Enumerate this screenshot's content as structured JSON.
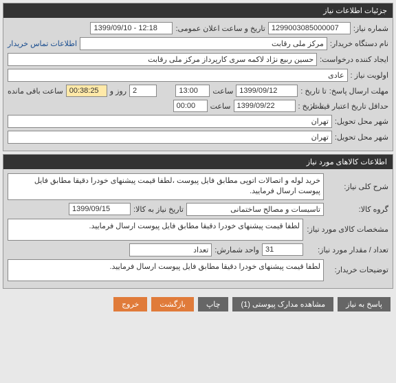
{
  "panel1": {
    "title": "جزئیات اطلاعات نیاز",
    "req_no_label": "شماره نیاز:",
    "req_no": "1299003085000007",
    "pub_date_label": "تاریخ و ساعت اعلان عمومی:",
    "pub_date": "1399/09/10 - 12:18",
    "buyer_label": "نام دستگاه خریدار:",
    "buyer": "مرکز ملی رقابت",
    "contact_link": "اطلاعات تماس خریدار",
    "creator_label": "ایجاد کننده درخواست:",
    "creator": "حسین ربیع نژاد لاکمه سری کارپرداز مرکز ملی رقابت",
    "priority_label": "اولویت نیاز :",
    "priority": "عادی",
    "deadline_label": "مهلت ارسال پاسخ:",
    "to_date_label": "تا تاریخ :",
    "deadline_date": "1399/09/12",
    "time_label": "ساعت",
    "deadline_time": "13:00",
    "days_val": "2",
    "days_label": "روز و",
    "remain_time": "00:38:25",
    "remain_label": "ساعت باقی مانده",
    "min_credit_label": "حداقل تاریخ اعتبار قیمت:",
    "min_credit_date": "1399/09/22",
    "min_credit_time": "00:00",
    "deliver_city_label": "شهر محل تحویل:",
    "deliver_city": "تهران",
    "deliver_city2_label": "شهر محل تحویل:",
    "deliver_city2": "تهران"
  },
  "panel2": {
    "title": "اطلاعات کالاهای مورد نیاز",
    "desc_label": "شرح کلی نیاز:",
    "desc": "خرید لوله و اتصالات اتوپی مطابق فایل پیوست ،لطفا قیمت پیشنهای خودرا دقیقا مطابق فایل پیوست ارسال فرمایید.",
    "group_label": "گروه کالا:",
    "group": "تاسیسات و مصالح ساختمانی",
    "need_date_label": "تاریخ نیاز به کالا:",
    "need_date": "1399/09/15",
    "spec_label": "مشخصات کالای مورد نیاز:",
    "spec": "لطفا قیمت پیشنهای خودرا دقیقا مطابق فایل پیوست ارسال فرمایید.",
    "qty_label": "تعداد / مقدار مورد نیاز:",
    "qty": "31",
    "unit_label": "واحد شمارش:",
    "unit": "تعداد",
    "buyer_note_label": "توضیحات خریدار:",
    "buyer_note": "لطفا قیمت پیشنهای خودرا دقیقا مطابق فایل پیوست ارسال فرمایید."
  },
  "buttons": {
    "respond": "پاسخ به نیاز",
    "attach": "مشاهده مدارک پیوستی (1)",
    "print": "چاپ",
    "back": "بازگشت",
    "exit": "خروج"
  }
}
